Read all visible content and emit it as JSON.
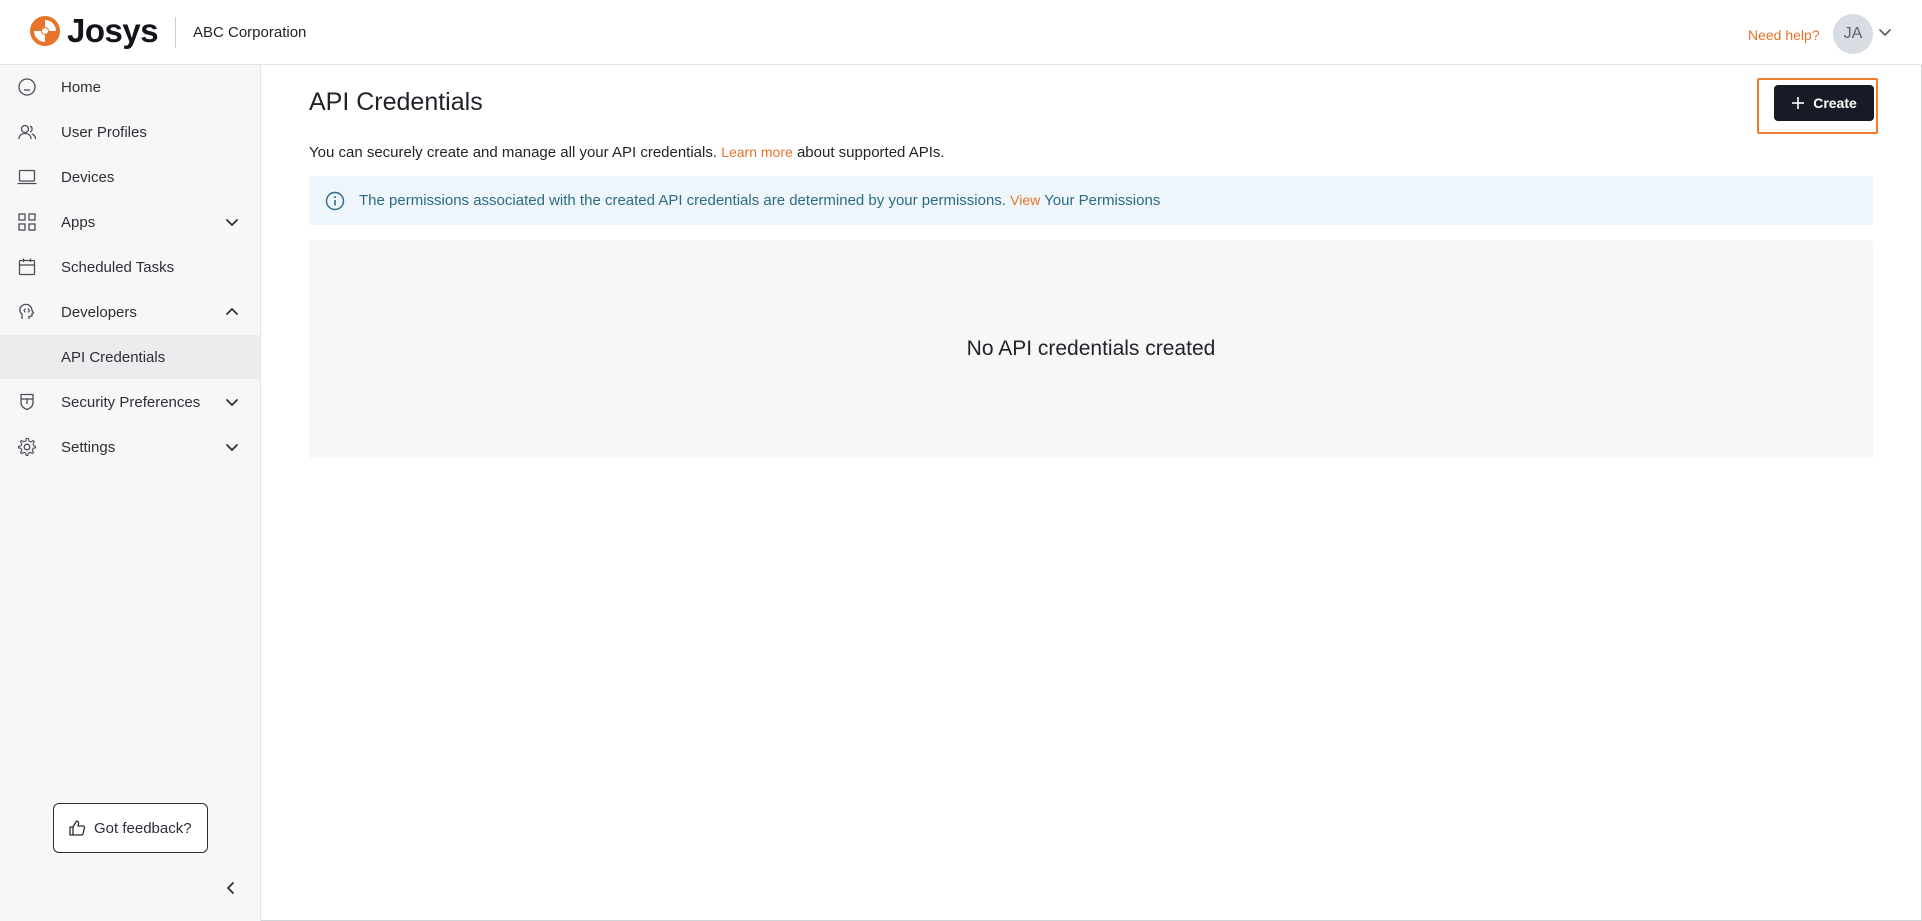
{
  "header": {
    "brand": "Josys",
    "org_name": "ABC Corporation",
    "help_label": "Need help?",
    "avatar_initials": "JA",
    "brand_color": "#e8732a"
  },
  "sidebar": {
    "items": [
      {
        "label": "Home",
        "icon": "home-icon"
      },
      {
        "label": "User Profiles",
        "icon": "users-icon"
      },
      {
        "label": "Devices",
        "icon": "laptop-icon"
      },
      {
        "label": "Apps",
        "icon": "grid-icon",
        "expanded": false
      },
      {
        "label": "Scheduled Tasks",
        "icon": "calendar-icon"
      },
      {
        "label": "Developers",
        "icon": "developer-icon",
        "expanded": true
      },
      {
        "label": "API Credentials",
        "active": true
      },
      {
        "label": "Security Preferences",
        "icon": "shield-icon",
        "expanded": false
      },
      {
        "label": "Settings",
        "icon": "gear-icon",
        "expanded": false
      }
    ],
    "feedback_label": "Got feedback?"
  },
  "main": {
    "title": "API Credentials",
    "create_label": "Create",
    "description_before": "You can securely create and manage all your API credentials.",
    "description_link": "Learn more",
    "description_after": "about supported APIs.",
    "info_text": "The permissions associated with the created API credentials are determined by your permissions.",
    "info_link": "View",
    "info_after": "Your Permissions",
    "empty_message": "No API credentials created"
  }
}
